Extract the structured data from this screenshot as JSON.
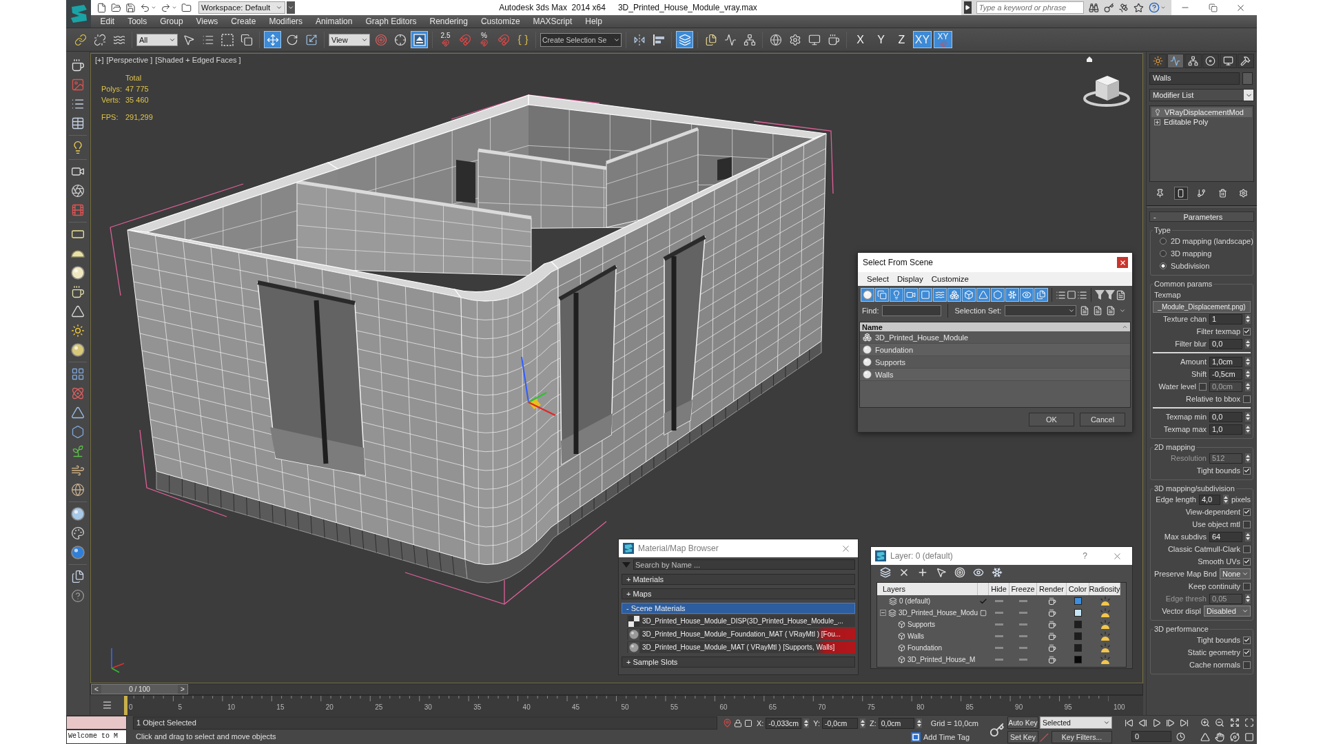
{
  "title_bar": {
    "workspace": "Workspace: Default",
    "app_name": "Autodesk 3ds Max  2014 x64",
    "file_name": "3D_Printed_House_Module_vray.max",
    "search": {
      "placeholder": "Type a keyword or phrase"
    }
  },
  "menu": [
    "Edit",
    "Tools",
    "Group",
    "Views",
    "Create",
    "Modifiers",
    "Animation",
    "Graph Editors",
    "Rendering",
    "Customize",
    "MAXScript",
    "Help"
  ],
  "main_toolbar": [
    {
      "kind": "tool",
      "selected": false
    },
    {
      "kind": "tool",
      "selected": false
    },
    {
      "kind": "tool",
      "selected": false
    },
    {
      "kind": "dropdown",
      "value": "All"
    },
    {
      "kind": "tool",
      "selected": false
    },
    {
      "kind": "tool",
      "selected": false
    },
    {
      "kind": "tool",
      "selected": false
    },
    {
      "kind": "tool",
      "selected": false
    },
    {
      "kind": "tool",
      "selected": true
    },
    {
      "kind": "tool",
      "selected": false
    },
    {
      "kind": "tool",
      "selected": false
    },
    {
      "kind": "dropdown",
      "value": "View"
    },
    {
      "kind": "tool",
      "selected": false
    },
    {
      "kind": "tool",
      "selected": false
    },
    {
      "kind": "tool",
      "selected": true
    },
    {
      "kind": "snap",
      "label": "2.5",
      "selected": false
    },
    {
      "kind": "tool",
      "selected": false
    },
    {
      "kind": "snap",
      "label": "%",
      "selected": false
    },
    {
      "kind": "tool",
      "selected": false
    },
    {
      "kind": "tool",
      "selected": false
    },
    {
      "kind": "field",
      "placeholder": "Create Selection Se"
    },
    {
      "kind": "tool",
      "selected": false
    },
    {
      "kind": "tool",
      "selected": false
    },
    {
      "kind": "tool",
      "selected": true
    },
    {
      "kind": "tool",
      "selected": false
    },
    {
      "kind": "tool",
      "selected": false
    },
    {
      "kind": "tool",
      "selected": false
    },
    {
      "kind": "tool",
      "selected": false
    },
    {
      "kind": "tool",
      "selected": false
    },
    {
      "kind": "tool",
      "selected": false
    },
    {
      "kind": "tool",
      "selected": false
    },
    {
      "kind": "axis",
      "label": "X",
      "selected": false
    },
    {
      "kind": "axis",
      "label": "Y",
      "selected": false
    },
    {
      "kind": "axis",
      "label": "Z",
      "selected": false
    },
    {
      "kind": "axis",
      "label": "XY",
      "selected": true
    },
    {
      "kind": "axis_snap",
      "label": "XY",
      "selected": true
    }
  ],
  "viewport": {
    "labels": [
      "[+]",
      "[Perspective ]",
      "[Shaded + Edged Faces ]"
    ],
    "stats_title": "Total",
    "stats": [
      {
        "label": "Polys:",
        "value": "47 775"
      },
      {
        "label": "Verts:",
        "value": "35 460"
      }
    ],
    "fps": {
      "label": "FPS:",
      "value": "291,299"
    }
  },
  "timeline": {
    "prev": "<",
    "frame": "0 / 100",
    "next": ">",
    "level": 0,
    "ticks": [
      "0",
      "5",
      "10",
      "15",
      "20",
      "25",
      "30",
      "35",
      "40",
      "45",
      "50",
      "55",
      "60",
      "65",
      "70",
      "75",
      "80",
      "85",
      "90",
      "95",
      "100"
    ]
  },
  "command_panel": {
    "tabs": [
      {
        "selected": false
      },
      {
        "selected": true
      },
      {
        "selected": false
      },
      {
        "selected": false
      },
      {
        "selected": false
      },
      {
        "selected": false
      }
    ],
    "object_name": "Walls",
    "modifier_list": "Modifier List",
    "stack": [
      {
        "kind": "modifier",
        "label": "VRayDisplacementMod",
        "selected": true
      },
      {
        "kind": "base",
        "label": "Editable Poly",
        "selected": false
      }
    ],
    "stack_tools": [
      {
        "selected": false
      },
      {
        "selected": true
      },
      {
        "selected": false
      },
      {
        "selected": false
      },
      {
        "selected": false
      }
    ],
    "rollout": {
      "toggle": "-",
      "title": "Parameters"
    },
    "groups": [
      {
        "title": "Type",
        "rows": [
          {
            "kind": "radio",
            "label": "2D mapping (landscape)",
            "selected": false
          },
          {
            "kind": "radio",
            "label": "3D mapping",
            "selected": false
          },
          {
            "kind": "radio",
            "label": "Subdivision",
            "selected": true
          }
        ]
      },
      {
        "title": "Common params",
        "rows": [
          {
            "kind": "label",
            "label": "Texmap"
          },
          {
            "kind": "map_button",
            "value": "_Module_Displacement.png)"
          },
          {
            "kind": "spinner",
            "label": "Texture chan",
            "value": "1",
            "disabled": false
          },
          {
            "kind": "checkbox",
            "label": "Filter texmap",
            "checked": true
          },
          {
            "kind": "spinner",
            "label": "Filter blur",
            "value": "0,0",
            "disabled": false
          },
          {
            "kind": "separator"
          },
          {
            "kind": "spinner",
            "label": "Amount",
            "value": "1,0cm",
            "disabled": false
          },
          {
            "kind": "spinner",
            "label": "Shift",
            "value": "-0,5cm",
            "disabled": false
          },
          {
            "kind": "check_spinner",
            "label": "Water level",
            "checked": false,
            "value": "0,0cm",
            "disabled": true
          },
          {
            "kind": "checkbox",
            "label": "Relative to bbox",
            "checked": false
          },
          {
            "kind": "separator"
          },
          {
            "kind": "spinner",
            "label": "Texmap min",
            "value": "0,0",
            "disabled": false
          },
          {
            "kind": "spinner",
            "label": "Texmap max",
            "value": "1,0",
            "disabled": false
          }
        ]
      },
      {
        "title": "2D mapping",
        "rows": [
          {
            "kind": "spinner",
            "label": "Resolution",
            "value": "512",
            "disabled": true
          },
          {
            "kind": "checkbox",
            "label": "Tight bounds",
            "checked": true
          }
        ]
      },
      {
        "title": "3D mapping/subdivision",
        "rows": [
          {
            "kind": "spinner",
            "label": "Edge length",
            "value": "4,0",
            "unit": "pixels",
            "disabled": false
          },
          {
            "kind": "checkbox",
            "label": "View-dependent",
            "checked": true
          },
          {
            "kind": "checkbox",
            "label": "Use object mtl",
            "checked": false
          },
          {
            "kind": "spinner",
            "label": "Max subdivs",
            "value": "64",
            "disabled": false
          },
          {
            "kind": "checkbox",
            "label": "Classic Catmull-Clark",
            "checked": false
          },
          {
            "kind": "checkbox",
            "label": "Smooth UVs",
            "checked": true
          },
          {
            "kind": "dropdown",
            "label": "Preserve Map Bnd",
            "value": "None"
          },
          {
            "kind": "checkbox",
            "label": "Keep continuity",
            "checked": false
          },
          {
            "kind": "spinner",
            "label": "Edge thresh",
            "value": "0,05",
            "disabled": true
          },
          {
            "kind": "dropdown",
            "label": "Vector displ",
            "value": "Disabled"
          }
        ]
      },
      {
        "title": "3D performance",
        "rows": [
          {
            "kind": "checkbox",
            "label": "Tight bounds",
            "checked": true
          },
          {
            "kind": "checkbox",
            "label": "Static geometry",
            "checked": true
          },
          {
            "kind": "checkbox",
            "label": "Cache normals",
            "checked": false
          }
        ]
      }
    ]
  },
  "select_dialog": {
    "title": "Select From Scene",
    "menu": [
      "Select",
      "Display",
      "Customize"
    ],
    "filters": [
      {
        "selected": true
      },
      {
        "selected": true
      },
      {
        "selected": true
      },
      {
        "selected": true
      },
      {
        "selected": true
      },
      {
        "selected": true
      },
      {
        "selected": true
      },
      {
        "selected": true
      },
      {
        "selected": true
      },
      {
        "selected": true
      },
      {
        "selected": true
      },
      {
        "selected": true
      },
      {
        "selected": true
      }
    ],
    "find_label": "Find:",
    "selection_set_label": "Selection Set:",
    "column": "Name",
    "rows": [
      {
        "kind": "group",
        "name": "3D_Printed_House_Module",
        "selected": false
      },
      {
        "kind": "object",
        "name": "Foundation",
        "selected": false
      },
      {
        "kind": "object",
        "name": "Supports",
        "selected": false
      },
      {
        "kind": "object",
        "name": "Walls",
        "selected": false
      }
    ],
    "buttons": [
      "OK",
      "Cancel"
    ]
  },
  "material_browser": {
    "title": "Material/Map Browser",
    "search": {
      "placeholder": "Search by Name ..."
    },
    "groups": [
      {
        "toggle": "+",
        "label": "Materials",
        "selected": false
      },
      {
        "toggle": "+",
        "label": "Maps",
        "selected": false
      },
      {
        "toggle": "-",
        "label": "Scene Materials",
        "selected": true,
        "items": [
          {
            "kind": "map",
            "label": "3D_Printed_House_Module_DISP(3D_Printed_House_Module_...",
            "marked": false
          },
          {
            "kind": "material",
            "label": "3D_Printed_House_Module_Foundation_MAT ( VRayMtl ) [Fou...",
            "marked": true
          },
          {
            "kind": "material",
            "label": "3D_Printed_House_Module_MAT ( VRayMtl ) [Supports, Walls]",
            "marked": true
          }
        ]
      },
      {
        "toggle": "+",
        "label": "Sample Slots",
        "selected": false
      }
    ]
  },
  "layer_dialog": {
    "title": "Layer: 0 (default)",
    "help": "?",
    "columns": [
      "Layers",
      "Hide",
      "Freeze",
      "Render",
      "Color",
      "Radiosity"
    ],
    "layers": [
      {
        "name": "0 (default)",
        "current": true,
        "color": "#3d8fe0"
      },
      {
        "name": "3D_Printed_House_Modu",
        "current": false,
        "expanded": true,
        "color": "#c6e6f6",
        "children": [
          {
            "name": "Supports",
            "color": "#1e1e1e"
          },
          {
            "name": "Walls",
            "color": "#1e1e1e"
          },
          {
            "name": "Foundation",
            "color": "#1e1e1e"
          },
          {
            "name": "3D_Printed_House_M",
            "color": "#080808"
          }
        ]
      }
    ]
  },
  "status_bar": {
    "listener": "Welcome to M",
    "selection": "1 Object Selected",
    "prompt": "Click and drag to select and move objects",
    "coords": [
      {
        "axis": "X:",
        "value": "-0,033cm"
      },
      {
        "axis": "Y:",
        "value": "-0,0cm"
      },
      {
        "axis": "Z:",
        "value": "0,0cm"
      }
    ],
    "grid": "Grid = 10,0cm",
    "time_tag": "Add Time Tag",
    "auto_key": "Auto Key",
    "key_mode": "Selected",
    "set_key": "Set Key",
    "key_filters": "Key Filters...",
    "frame": "0"
  }
}
